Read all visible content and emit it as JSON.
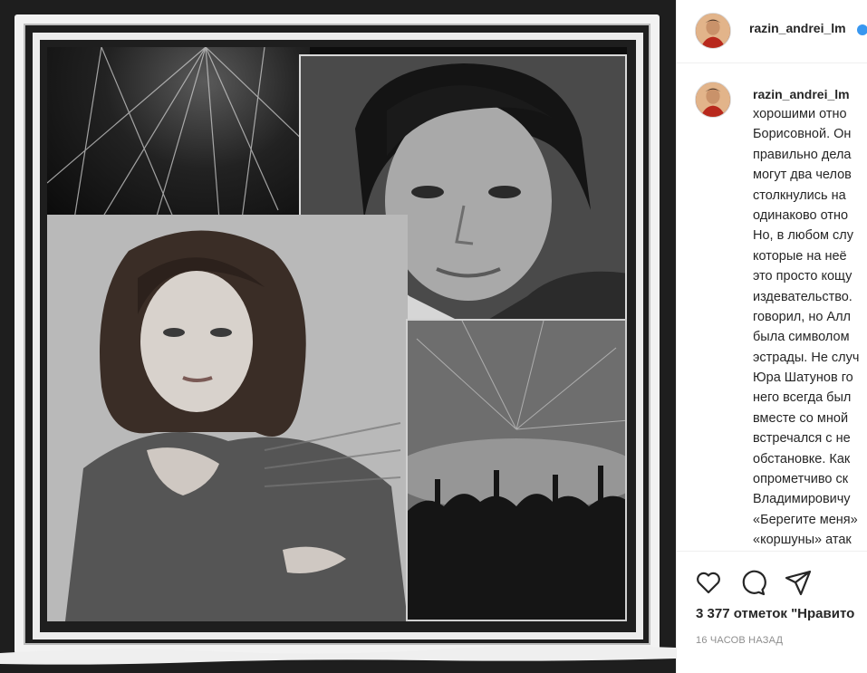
{
  "post": {
    "image_alt": "Коллаж: Алла Пугачёва, Юрий Шатунов, зрители на концерте"
  },
  "header": {
    "username": "razin_andrei_lm"
  },
  "caption": {
    "username": "razin_andrei_lm",
    "lines": [
      "хорошими отно",
      "Борисовной. Он",
      "правильно дела",
      "могут два челов",
      "столкнулись на",
      "одинаково отно",
      "Но, в любом слу",
      "которые на неё",
      "это просто кощу",
      "издевательство.",
      "говорил, но Алл",
      "была символом",
      "эстрады. Не случ",
      "Юра Шатунов го",
      "него всегда был",
      "вместе со мной",
      "встречался с не",
      "обстановке. Как",
      "опрометчиво ск",
      "Владимировичу",
      "«Берегите меня»",
      "«коршуны» атак"
    ]
  },
  "actions": {
    "like_icon": "heart-icon",
    "comment_icon": "comment-icon",
    "share_icon": "paper-plane-icon"
  },
  "likes_text": "3 377 отметок \"Нравито",
  "timestamp": "16 ЧАСОВ НАЗАД",
  "colors": {
    "accent": "#3897f0",
    "text": "#262626",
    "muted": "#8e8e8e",
    "border": "#efefef"
  }
}
